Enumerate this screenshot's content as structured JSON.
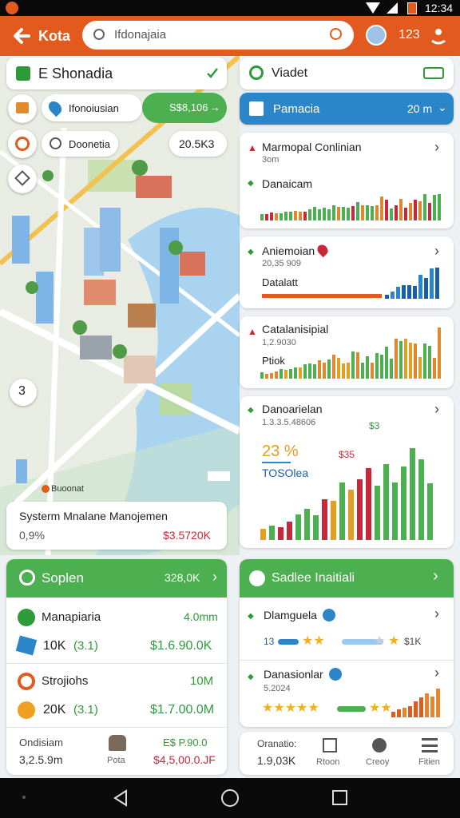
{
  "status": {
    "time": "12:34"
  },
  "appbar": {
    "title": "Kota",
    "search_value": "Ifdonajaia",
    "count": "123"
  },
  "map": {
    "header_title": "E Shonadia",
    "chip1": "Ifonoiusian",
    "chip1_value": "S$8,106",
    "chip2": "Doonetia",
    "chip2_value": "20.5K3",
    "marker_number": "3",
    "map_label": "Buoonat",
    "sheet_title": "Systerm Mnalane Manojemen",
    "sheet_left": "0,9%",
    "sheet_right": "$3.5720K"
  },
  "summary": {
    "title": "Soplen",
    "header_value": "328,0K",
    "rows": [
      {
        "label": "Manapiaria",
        "value": "4.0mm"
      },
      {
        "label": "10K",
        "sub": "(3.1)",
        "value": "$1.6.90.0K"
      },
      {
        "label": "Strojiohs",
        "value": "10M"
      },
      {
        "label": "20K",
        "sub": "(3.1)",
        "value": "$1.7.00.0M"
      }
    ],
    "footer_left_title": "Ondisiam",
    "footer_left_value": "3,2.5.9m",
    "footer_mid": "Pota",
    "footer_right_title": "E$ P.90.0",
    "footer_right_value": "$4,5,00.0.JF"
  },
  "right": {
    "top_title": "Viadet",
    "blue_title": "Pamacia",
    "blue_value": "20 m",
    "section1": {
      "title": "Marmopal Conlinian",
      "sub": "3om",
      "label": "Danaicam"
    },
    "section2": {
      "title": "Aniemoian",
      "sub": "20,35 909",
      "label": "Datalatt"
    },
    "section3": {
      "title": "Catalanisipial",
      "sub": "1,2.9030",
      "label": "Ptiok"
    },
    "section4": {
      "title": "Danoarielan",
      "sub": "1.3.3.5.48606",
      "big": "23 %",
      "big_sub": "TOSOlea",
      "value1": "$3",
      "value2": "$35"
    },
    "green_title": "Sadlee Inaitiali",
    "ratings": [
      {
        "title": "Dlamguela",
        "sub": "13",
        "value": "$1K"
      },
      {
        "title": "Danasionlar",
        "sub": "5.2024"
      }
    ],
    "footer_left_title": "Oranatio:",
    "footer_left_value": "1.9,03K",
    "nav": [
      "Rtoon",
      "Creoy",
      "Fitien"
    ]
  },
  "colors": {
    "accent": "#e25a1e",
    "green": "#4caf50",
    "blue": "#2a86c8",
    "red": "#c7283a"
  }
}
